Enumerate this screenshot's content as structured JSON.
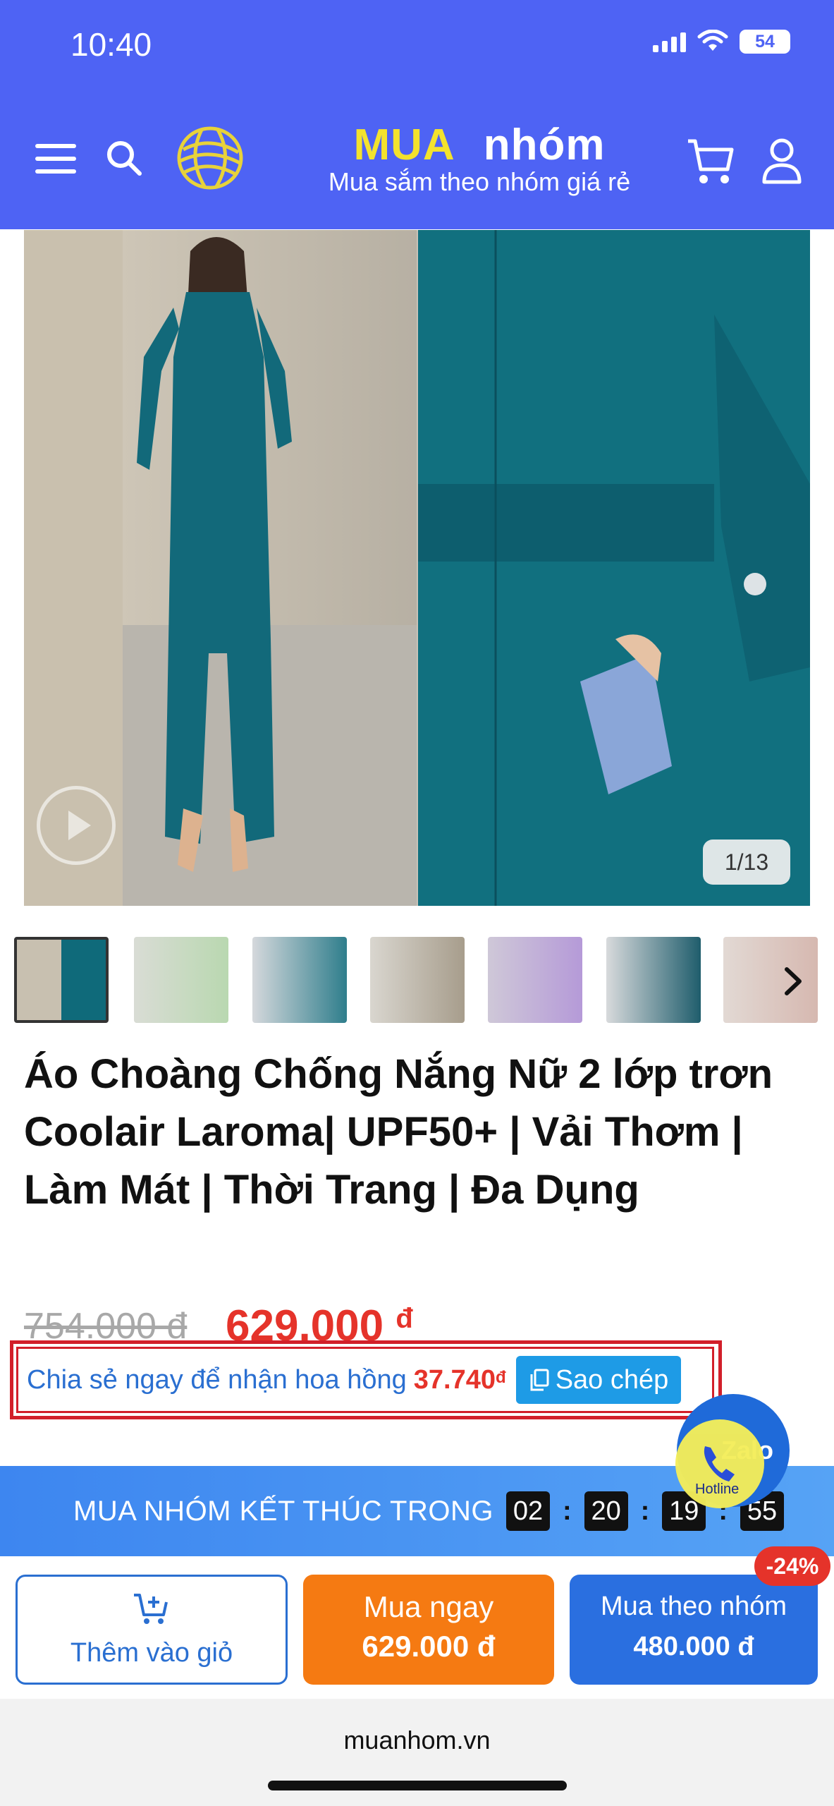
{
  "status_bar": {
    "time": "10:40",
    "battery": "54"
  },
  "header": {
    "logo_word1": "MUA",
    "logo_word2": "nhóm",
    "tagline": "Mua sắm theo nhóm giá rẻ",
    "icons": [
      "menu-icon",
      "search-icon",
      "globe-logo",
      "cart-icon",
      "user-icon"
    ]
  },
  "gallery": {
    "page_indicator": "1/13",
    "thumbnail_count": 7
  },
  "product": {
    "title": "Áo Choàng Chống Nắng Nữ 2 lớp trơn Coolair Laroma| UPF50+ | Vải Thơm | Làm Mát | Thời Trang | Đa Dụng",
    "old_price": "754.000 đ",
    "new_price": "629.000",
    "currency": "đ"
  },
  "share": {
    "text": "Chia sẻ ngay để nhận hoa hồng",
    "amount": "37.740",
    "currency": "đ",
    "copy_label": "Sao chép"
  },
  "countdown": {
    "label": "MUA NHÓM KẾT THÚC TRONG",
    "h": "02",
    "m": "20",
    "s": "19",
    "ms": "55"
  },
  "floating": {
    "zalo": "Zalo",
    "hotline": "Hotline"
  },
  "actions": {
    "add_to_cart": "Thêm vào giỏ",
    "buy_now": "Mua ngay",
    "buy_now_price": "629.000 đ",
    "group_buy": "Mua theo nhóm",
    "group_price": "480.000 đ",
    "discount": "-24%"
  },
  "footer": {
    "url": "muanhom.vn"
  },
  "colors": {
    "header_bg": "#4e63f4",
    "price_red": "#e5332a",
    "link_blue": "#2a6fd1",
    "buy_orange": "#f57a12",
    "group_blue": "#2a6fe0"
  }
}
